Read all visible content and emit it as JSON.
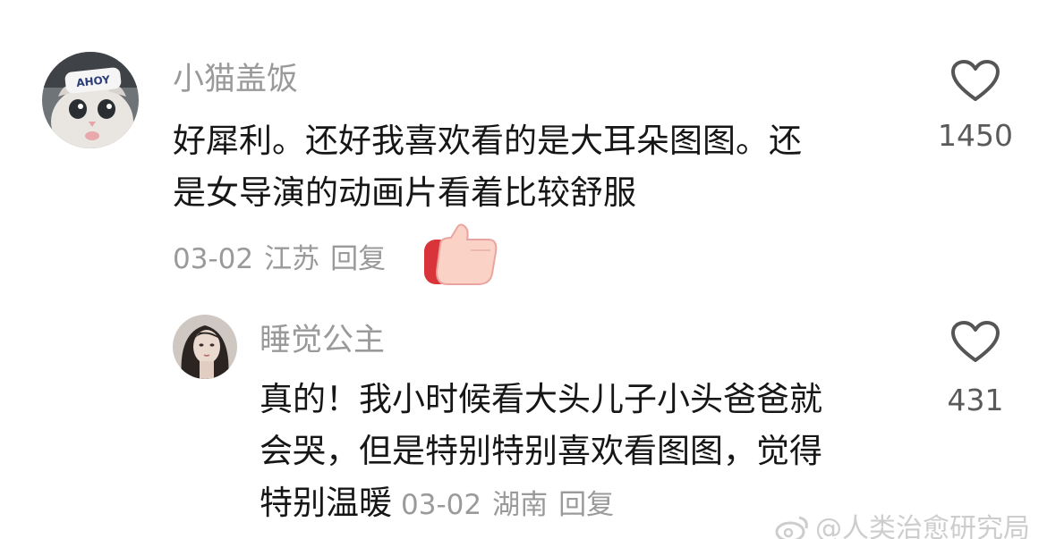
{
  "comments": [
    {
      "username": "小猫盖饭",
      "lines": [
        "好犀利。还好我喜欢看的是大耳朵图图。还",
        "是女导演的动画片看着比较舒服"
      ],
      "date": "03-02",
      "location": "江苏",
      "reply_label": "回复",
      "like_count": "1450",
      "avatar_cap_text": "AHOY",
      "reaction": "thumbs-up-icon"
    },
    {
      "username": "睡觉公主",
      "lines": [
        "真的！我小时候看大头儿子小头爸爸就",
        "会哭，但是特别特别喜欢看图图，觉得",
        "特别温暖"
      ],
      "date": "03-02",
      "location": "湖南",
      "reply_label": "回复",
      "like_count": "431"
    }
  ],
  "watermark": "@人类治愈研究局",
  "colors": {
    "username": "#9a9a9a",
    "body": "#161616",
    "meta": "#9a9a9a",
    "like_count": "#5a5a5a",
    "thumb_red": "#d9343a",
    "thumb_skin": "#fbd3c6"
  },
  "icons": [
    "heart-outline-icon",
    "thumbs-up-icon",
    "weibo-logo-icon"
  ]
}
